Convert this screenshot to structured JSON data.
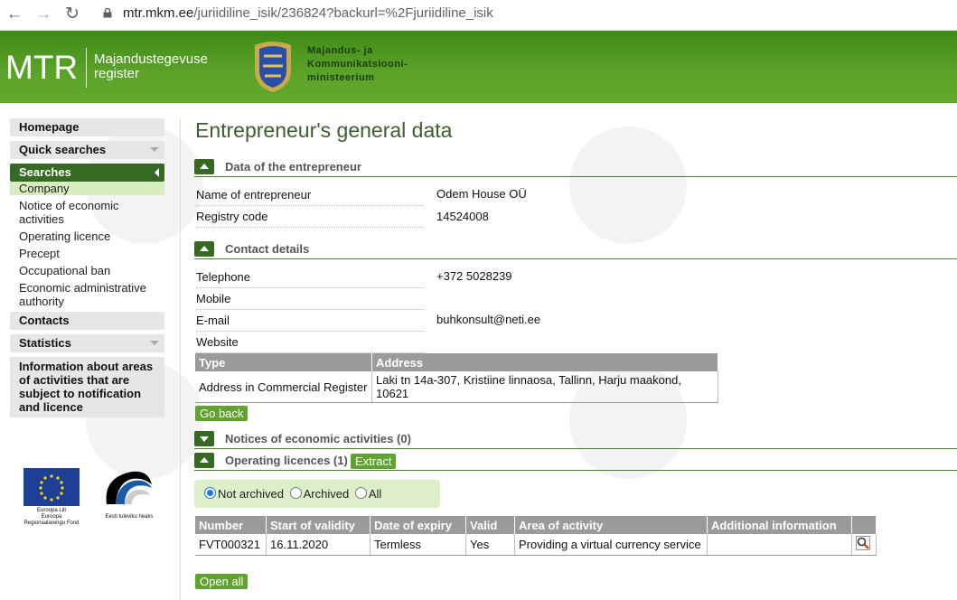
{
  "browser": {
    "url_host": "mtr.mkm.ee",
    "url_path": "/juriidiline_isik/236824?backurl=%2Fjuriidiline_isik"
  },
  "header": {
    "logo": "MTR",
    "logo_sub_1": "Majandustegevuse",
    "logo_sub_2": "register",
    "ministry_1": "Majandus- ja",
    "ministry_2": "Kommunikatsiooni-",
    "ministry_3": "ministeerium"
  },
  "sidebar": {
    "homepage": "Homepage",
    "quick_searches": "Quick searches",
    "searches": "Searches",
    "search_items": [
      "Company",
      "Notice of economic activities",
      "Operating licence",
      "Precept",
      "Occupational ban",
      "Economic administrative authority"
    ],
    "contacts": "Contacts",
    "statistics": "Statistics",
    "info": "Information about areas of activities that are subject to notification and licence",
    "eu_text_1": "Euroopa Liit",
    "eu_text_2": "Euroopa",
    "eu_text_3": "Regionaalarengu Fond",
    "ee_text": "Eesti tuleviku heaks"
  },
  "main": {
    "title": "Entrepreneur's general data",
    "section_entrepreneur": "Data of the entrepreneur",
    "name_label": "Name of entrepreneur",
    "name_value": "Odem House OÜ",
    "reg_label": "Registry code",
    "reg_value": "14524008",
    "section_contact": "Contact details",
    "phone_label": "Telephone",
    "phone_value": "+372 5028239",
    "mobile_label": "Mobile",
    "email_label": "E-mail",
    "email_value": "buhkonsult@neti.ee",
    "website_label": "Website",
    "address_table": {
      "headers": [
        "Type",
        "Address"
      ],
      "rows": [
        [
          "Address in Commercial Register",
          "Laki tn 14a-307, Kristiine linnaosa, Tallinn, Harju maakond, 10621"
        ]
      ]
    },
    "go_back": "Go back",
    "notices_section": "Notices of economic activities (0)",
    "licences_section": "Operating licences (1)",
    "extract_button": "Extract",
    "filter": {
      "not_archived": "Not archived",
      "archived": "Archived",
      "all": "All",
      "selected": "Not archived"
    },
    "licence_table": {
      "headers": [
        "Number",
        "Start of validity",
        "Date of expiry",
        "Valid",
        "Area of activity",
        "Additional information",
        ""
      ],
      "rows": [
        [
          "FVT000321",
          "16.11.2020",
          "Termless",
          "Yes",
          "Providing a virtual currency service",
          ""
        ]
      ]
    },
    "open_all": "Open all"
  }
}
